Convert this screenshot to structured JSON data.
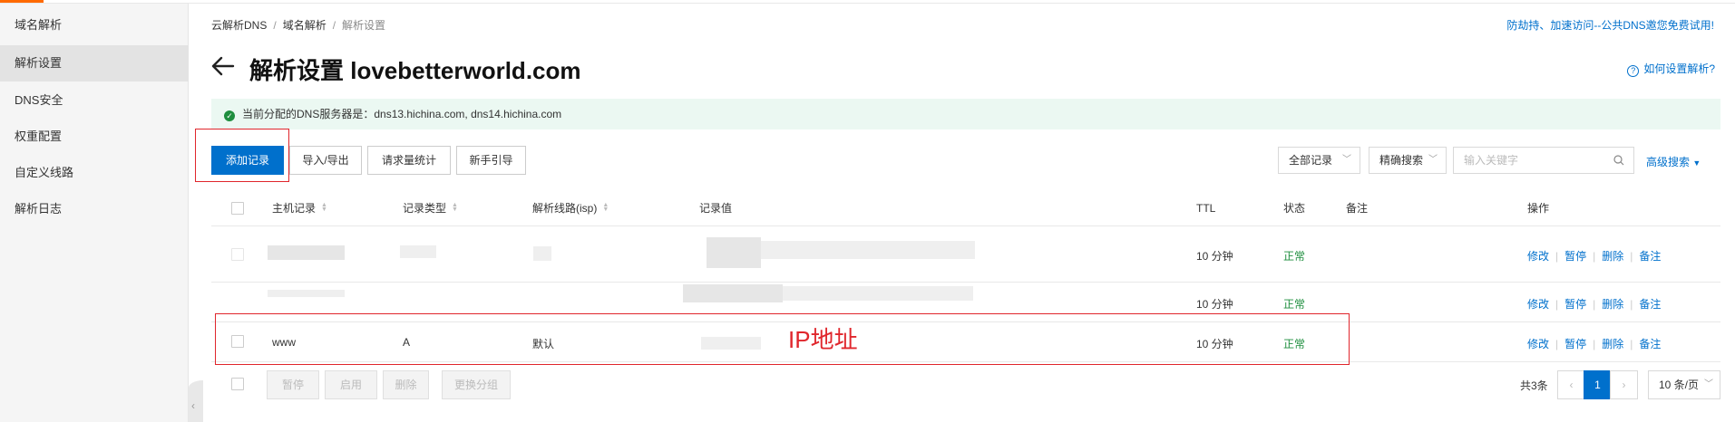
{
  "sidebar": {
    "items": [
      {
        "label": "域名解析"
      },
      {
        "label": "解析设置"
      },
      {
        "label": "DNS安全"
      },
      {
        "label": "权重配置"
      },
      {
        "label": "自定义线路"
      },
      {
        "label": "解析日志"
      }
    ]
  },
  "breadcrumb": [
    "云解析DNS",
    "域名解析",
    "解析设置"
  ],
  "promo": "防劫持、加速访问--公共DNS邀您免费试用!",
  "title": "解析设置 lovebetterworld.com",
  "help": "如何设置解析?",
  "notice": {
    "prefix": "当前分配的DNS服务器是：",
    "servers": "dns13.hichina.com, dns14.hichina.com"
  },
  "toolbar": {
    "add": "添加记录",
    "import_export": "导入/导出",
    "stats": "请求量统计",
    "guide": "新手引导"
  },
  "filters": {
    "all_records": "全部记录",
    "exact_search": "精确搜索",
    "search_placeholder": "输入关键字",
    "advanced": "高级搜索"
  },
  "table": {
    "headers": [
      "主机记录",
      "记录类型",
      "解析线路(isp)",
      "记录值",
      "TTL",
      "状态",
      "备注",
      "操作"
    ],
    "rows": [
      {
        "host": "",
        "type": "",
        "line": "",
        "value": "",
        "ttl": "10 分钟",
        "status": "正常"
      },
      {
        "host": "",
        "type": "",
        "line": "",
        "value": "",
        "ttl": "10 分钟",
        "status": "正常"
      },
      {
        "host": "www",
        "type": "A",
        "line": "默认",
        "value": "",
        "ttl": "10 分钟",
        "status": "正常"
      }
    ],
    "ops": [
      "修改",
      "暂停",
      "删除",
      "备注"
    ]
  },
  "annotation": "IP地址",
  "footer": {
    "bulk": [
      "暂停",
      "启用",
      "删除",
      "更换分组"
    ],
    "total": "共3条",
    "current_page": "1",
    "page_size": "10 条/页"
  },
  "colors": {
    "accent": "#0070cc",
    "status_ok": "#1e8e3e",
    "annotation": "#e0262c",
    "brand_orange": "#ff6a00"
  }
}
